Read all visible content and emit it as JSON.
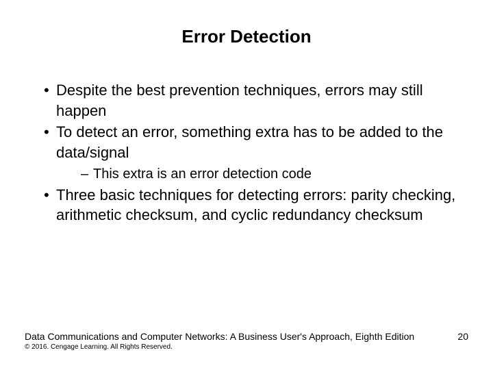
{
  "title": "Error Detection",
  "bullets": [
    {
      "text": "Despite the best prevention techniques, errors may still happen"
    },
    {
      "text": "To detect an error, something extra has to be added to the data/signal",
      "sub": [
        "This extra is an error detection code"
      ]
    },
    {
      "text": "Three basic techniques for detecting errors: parity checking, arithmetic checksum, and cyclic redundancy checksum"
    }
  ],
  "footer": {
    "source": "Data Communications and Computer Networks: A Business User's Approach, Eighth Edition",
    "copyright": "© 2016. Cengage Learning. All Rights Reserved.",
    "page": "20"
  }
}
